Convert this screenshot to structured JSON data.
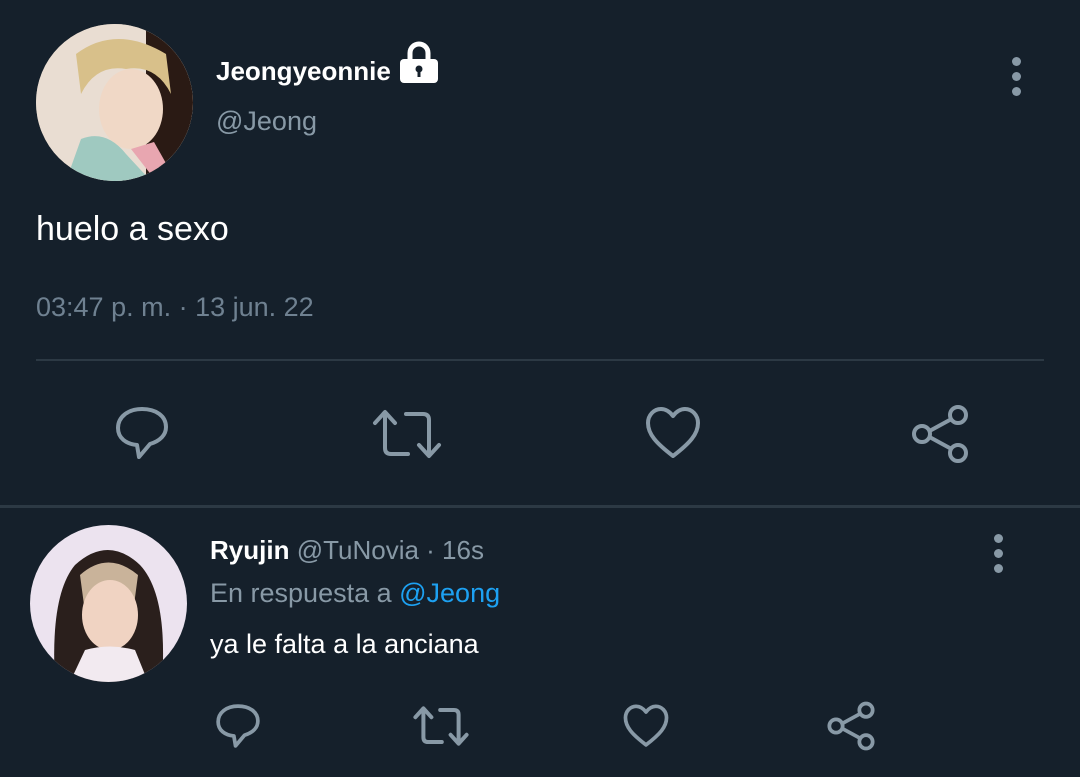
{
  "tweet": {
    "author_name": "Jeongyeonnie",
    "author_handle": "@Jeong",
    "locked": true,
    "text": "huelo a sexo",
    "timestamp": "03:47 p. m. · 13 jun. 22"
  },
  "reply": {
    "author_name": "Ryujin",
    "author_handle": "@TuNovia",
    "separator": " · ",
    "age": "16s",
    "reply_prefix": "En respuesta a ",
    "reply_mention": "@Jeong",
    "text": "ya le falta a la anciana"
  },
  "icons": {
    "reply": "reply-icon",
    "retweet": "retweet-icon",
    "like": "heart-icon",
    "share": "share-icon",
    "more": "more-vertical-icon",
    "lock": "lock-icon"
  },
  "colors": {
    "background": "#15202b",
    "primary_text": "#ffffff",
    "secondary_text": "#8899a6",
    "link": "#1da1f2",
    "divider": "#2c3944"
  }
}
